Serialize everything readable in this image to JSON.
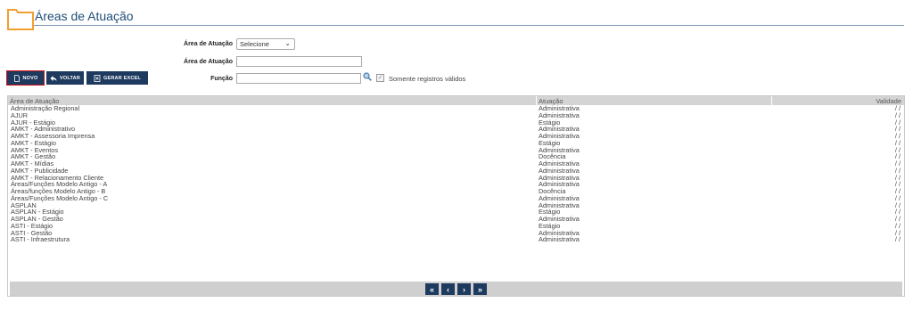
{
  "header": {
    "title": "Áreas de Atuação"
  },
  "filters": {
    "area_atuacao_select_label": "Área de Atuação",
    "area_atuacao_select_value": "Selecione",
    "area_atuacao_text_label": "Área de Atuação",
    "funcao_label": "Função",
    "somente_validos_label": "Somente registros válidos",
    "somente_validos_checked": true
  },
  "toolbar": {
    "novo_label": "NOVO",
    "voltar_label": "VOLTAR",
    "excel_label": "GERAR EXCEL"
  },
  "grid": {
    "columns": [
      "Área de Atuação",
      "Atuação",
      "Validade"
    ],
    "rows": [
      [
        "Administração Regional",
        "Administrativa",
        "/ /"
      ],
      [
        "AJUR",
        "Administrativa",
        "/ /"
      ],
      [
        "AJUR - Estágio",
        "Estágio",
        "/ /"
      ],
      [
        "AMKT - Administrativo",
        "Administrativa",
        "/ /"
      ],
      [
        "AMKT - Assessoria Imprensa",
        "Administrativa",
        "/ /"
      ],
      [
        "AMKT - Estágio",
        "Estágio",
        "/ /"
      ],
      [
        "AMKT - Eventos",
        "Administrativa",
        "/ /"
      ],
      [
        "AMKT - Gestão",
        "Docência",
        "/ /"
      ],
      [
        "AMKT - Mídias",
        "Administrativa",
        "/ /"
      ],
      [
        "AMKT - Publicidade",
        "Administrativa",
        "/ /"
      ],
      [
        "AMKT - Relacionamento Cliente",
        "Administrativa",
        "/ /"
      ],
      [
        "Áreas/Funções Modelo Antigo - A",
        "Administrativa",
        "/ /"
      ],
      [
        "Áreas/funções Modelo Antigo - B",
        "Docência",
        "/ /"
      ],
      [
        "Áreas/Funções Modelo Antigo - C",
        "Administrativa",
        "/ /"
      ],
      [
        "ASPLAN",
        "Administrativa",
        "/ /"
      ],
      [
        "ASPLAN - Estágio",
        "Estágio",
        "/ /"
      ],
      [
        "ASPLAN - Gestão",
        "Administrativa",
        "/ /"
      ],
      [
        "ASTI - Estágio",
        "Estágio",
        "/ /"
      ],
      [
        "ASTI - Gestão",
        "Administrativa",
        "/ /"
      ],
      [
        "ASTI - Infraestrutura",
        "Administrativa",
        "/ /"
      ]
    ]
  },
  "pager": {
    "first": "«",
    "prev": "‹",
    "next": "›",
    "last": "»"
  },
  "colors": {
    "accent": "#1e3a5f",
    "title": "#1f4e79",
    "folder": "#f0a030",
    "highlight": "#d0141c"
  }
}
